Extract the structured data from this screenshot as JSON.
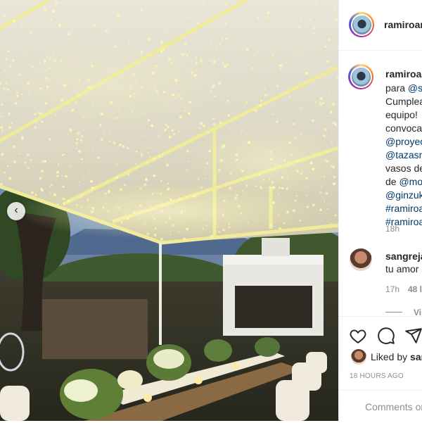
{
  "post": {
    "username": "ramiroar",
    "image_alt": "Outdoor dinner table under a canopy of string lights"
  },
  "caption": {
    "username": "ramiroar",
    "lines": [
      {
        "text": "para ",
        "tag": "@sa"
      },
      {
        "text": "Cumplea",
        "tag": ""
      },
      {
        "text": "equipo!",
        "tag": ""
      },
      {
        "text": "convocar",
        "tag": ""
      },
      {
        "text": "",
        "tag": "@proyec"
      },
      {
        "text": "",
        "tag": "@tazasm"
      },
      {
        "text": "vasos de",
        "tag": ""
      },
      {
        "text": "de ",
        "tag": "@mo"
      },
      {
        "text": "",
        "tag": "@ginzuk"
      },
      {
        "text": "",
        "tag": "#ramiroa"
      },
      {
        "text": "",
        "tag": "#ramiroa"
      }
    ],
    "time": "18h"
  },
  "comment": {
    "username": "sangreja",
    "text": "tu amor",
    "time": "17h",
    "likes": "48 l",
    "view_replies": "Vi"
  },
  "likes": {
    "prefix": "Liked by ",
    "user": "san"
  },
  "timestamp": "18 HOURS AGO",
  "add_comment": {
    "placeholder": "Comments or"
  },
  "icons": {
    "like": "heart-icon",
    "comment": "comment-bubble-icon",
    "share": "paper-plane-icon",
    "prev": "chevron-left-icon"
  },
  "colors": {
    "link": "#00376b",
    "text": "#262626",
    "muted": "#8e8e8e",
    "divider": "#efefef"
  }
}
